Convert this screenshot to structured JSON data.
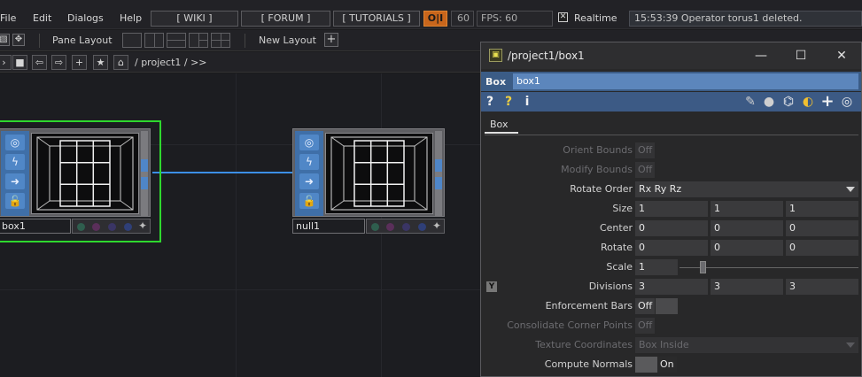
{
  "menubar": {
    "items": [
      "File",
      "Edit",
      "Dialogs",
      "Help"
    ],
    "wiki": "[ WIKI ]",
    "forum": "[ FORUM ]",
    "tutorials": "[ TUTORIALS ]",
    "oi": "O|I",
    "fps_target": "60",
    "fps": "FPS:  60",
    "realtime_check": "✕",
    "realtime": "Realtime",
    "status": "15:53:39 Operator torus1 deleted."
  },
  "layoutbar": {
    "pane_layout": "Pane Layout",
    "new_layout": "New Layout"
  },
  "pathbar": {
    "path": "/ project1 / >>"
  },
  "nodes": {
    "box1": {
      "name": "box1"
    },
    "null1": {
      "name": "null1"
    }
  },
  "param": {
    "title": "/project1/box1",
    "op_type": "Box",
    "op_name": "box1",
    "tab": "Box",
    "rows": {
      "orient_bounds": {
        "label": "Orient Bounds",
        "value": "Off"
      },
      "modify_bounds": {
        "label": "Modify Bounds",
        "value": "Off"
      },
      "rotate_order": {
        "label": "Rotate Order",
        "value": "Rx Ry Rz"
      },
      "size": {
        "label": "Size",
        "values": [
          "1",
          "1",
          "1"
        ]
      },
      "center": {
        "label": "Center",
        "values": [
          "0",
          "0",
          "0"
        ]
      },
      "rotate": {
        "label": "Rotate",
        "values": [
          "0",
          "0",
          "0"
        ]
      },
      "scale": {
        "label": "Scale",
        "value": "1",
        "slider": 0.12
      },
      "divisions": {
        "label": "Divisions",
        "values": [
          "3",
          "3",
          "3"
        ],
        "flag": "Y"
      },
      "enforcement_bars": {
        "label": "Enforcement Bars",
        "value": "Off"
      },
      "consolidate": {
        "label": "Consolidate Corner Points",
        "value": "Off"
      },
      "texture_coords": {
        "label": "Texture Coordinates",
        "value": "Box Inside"
      },
      "compute_normals": {
        "label": "Compute Normals",
        "value": "On"
      }
    }
  },
  "colors": {
    "selected_outline": "#2ed82e",
    "wire": "#3c8fe6",
    "param_header": "#3b5c86",
    "oi_button": "#c8661c"
  }
}
